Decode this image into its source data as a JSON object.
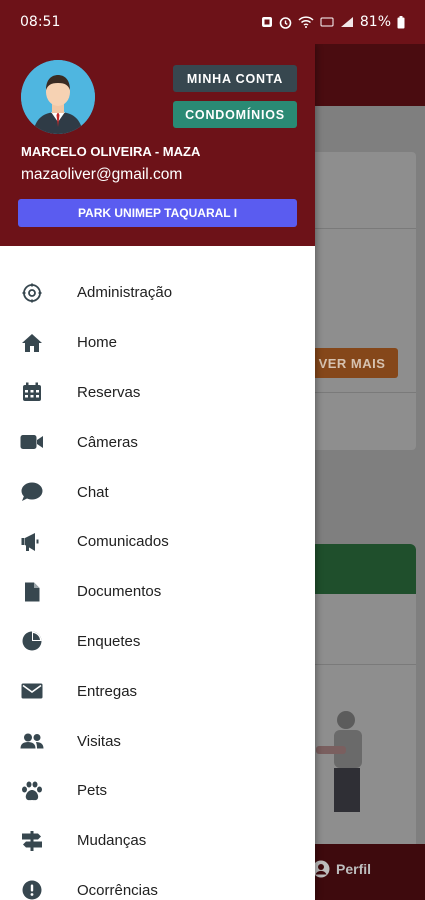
{
  "status_bar": {
    "time": "08:51",
    "battery": "81%",
    "icons": [
      "notification-icon",
      "alarm-icon",
      "wifi-icon",
      "volte-icon",
      "signal-icon",
      "battery-icon"
    ]
  },
  "drawer": {
    "user_name": "MARCELO OLIVEIRA - MAZA",
    "user_email": "mazaoliver@gmail.com",
    "my_account_label": "MINHA CONTA",
    "condos_label": "CONDOMÍNIOS",
    "condo_label": "PARK UNIMEP TAQUARAL I",
    "menu": [
      {
        "label": "Administração",
        "icon": "admin-gear-icon"
      },
      {
        "label": "Home",
        "icon": "home-icon"
      },
      {
        "label": "Reservas",
        "icon": "calendar-icon"
      },
      {
        "label": "Câmeras",
        "icon": "video-camera-icon"
      },
      {
        "label": "Chat",
        "icon": "chat-bubble-icon"
      },
      {
        "label": "Comunicados",
        "icon": "megaphone-icon"
      },
      {
        "label": "Documentos",
        "icon": "document-icon"
      },
      {
        "label": "Enquetes",
        "icon": "pie-chart-icon"
      },
      {
        "label": "Entregas",
        "icon": "envelope-icon"
      },
      {
        "label": "Visitas",
        "icon": "users-icon"
      },
      {
        "label": "Pets",
        "icon": "paw-icon"
      },
      {
        "label": "Mudanças",
        "icon": "signpost-icon"
      },
      {
        "label": "Ocorrências",
        "icon": "alert-circle-icon"
      }
    ]
  },
  "background": {
    "see_more_label": "VER MAIS",
    "profile_label": "Perfil"
  },
  "colors": {
    "header": "#6d1218",
    "my_account_button": "#37474f",
    "condos_button": "#2a8a74",
    "condo_button": "#5a5cf0",
    "icon": "#37474f"
  }
}
